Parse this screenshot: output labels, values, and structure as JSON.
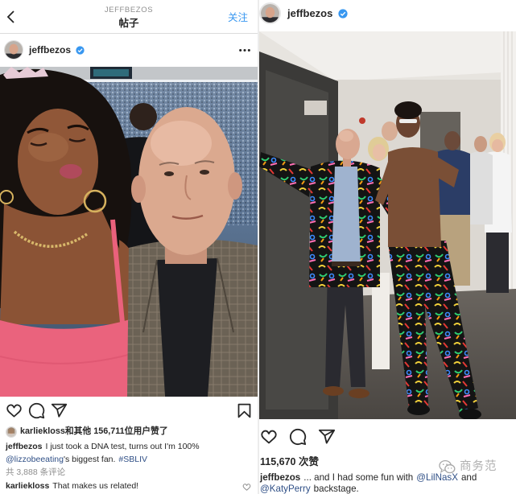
{
  "left_post": {
    "header": {
      "account": "JEFFBEZOS",
      "title": "帖子",
      "follow_label": "关注",
      "back_icon": "chevron-left-icon"
    },
    "author": {
      "username": "jeffbezos",
      "verified_icon": "verified-badge-icon",
      "more_icon": "more-options-icon"
    },
    "actions": {
      "icons": [
        "heart-icon",
        "comment-icon",
        "share-icon",
        "bookmark-icon"
      ]
    },
    "likes": {
      "user": "karliekloss",
      "rest": "和其他 156,711位用户赞了"
    },
    "caption": {
      "user": "jeffbezos",
      "text": "I just took a DNA test, turns out I'm 100%",
      "mention": "@lizzobeeating",
      "mention_suffix": "'s biggest fan.",
      "hashtag": "#SBLIV"
    },
    "comments_count": "共 3,888 条评论",
    "top_comment": {
      "user": "karliekloss",
      "text": "That makes us related!",
      "like_icon": "small-heart-icon"
    }
  },
  "right_post": {
    "author": {
      "username": "jeffbezos",
      "verified_icon": "verified-badge-icon"
    },
    "actions": {
      "icons": [
        "heart-icon",
        "comment-icon",
        "share-icon"
      ]
    },
    "likes": "115,670 次赞",
    "caption": {
      "user": "jeffbezos",
      "text": "... and I had some fun with",
      "mention_1": "@LilNasX",
      "joiner": "and",
      "mention_2": "@KatyPerry",
      "text_end": "backstage."
    }
  },
  "watermark": {
    "text": "商务范",
    "icon": "wechat-icon"
  },
  "colors": {
    "text": "#262626",
    "secondary": "#8e8e8e",
    "link": "#2f4f86",
    "follow": "#3897f0",
    "verified": "#3897f0"
  }
}
